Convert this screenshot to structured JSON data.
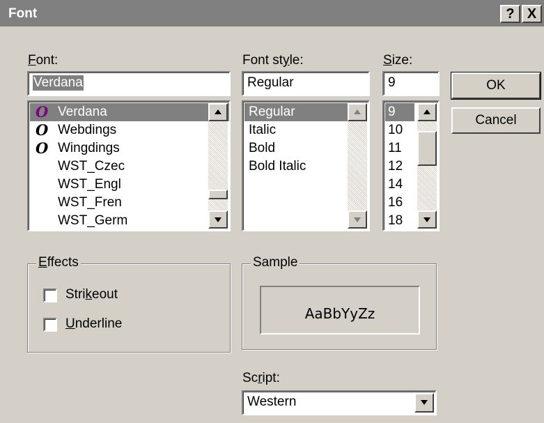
{
  "window": {
    "title": "Font",
    "help_label": "?",
    "close_label": "X"
  },
  "font": {
    "label_first": "F",
    "label_rest": "ont:",
    "value": "Verdana",
    "items": [
      {
        "name": "Verdana",
        "icon": "opentype-icon",
        "glyph": "O"
      },
      {
        "name": "Webdings",
        "icon": "opentype-icon",
        "glyph": "O"
      },
      {
        "name": "Wingdings",
        "icon": "opentype-icon",
        "glyph": "O"
      },
      {
        "name": "WST_Czec",
        "icon": "",
        "glyph": ""
      },
      {
        "name": "WST_Engl",
        "icon": "",
        "glyph": ""
      },
      {
        "name": "WST_Fren",
        "icon": "",
        "glyph": ""
      },
      {
        "name": "WST_Germ",
        "icon": "",
        "glyph": ""
      }
    ],
    "selected": "Verdana"
  },
  "style": {
    "label_pre": "Font st",
    "label_u": "y",
    "label_post": "le:",
    "value": "Regular",
    "items": [
      "Regular",
      "Italic",
      "Bold",
      "Bold Italic"
    ],
    "selected": "Regular"
  },
  "size": {
    "label_u": "S",
    "label_post": "ize:",
    "value": "9",
    "items": [
      "9",
      "10",
      "11",
      "12",
      "14",
      "16",
      "18"
    ],
    "selected": "9"
  },
  "buttons": {
    "ok": "OK",
    "cancel": "Cancel"
  },
  "effects": {
    "legend_u": "E",
    "legend_post": "ffects",
    "strikeout_pre": "Stri",
    "strikeout_u": "k",
    "strikeout_post": "eout",
    "underline_u": "U",
    "underline_post": "nderline",
    "strikeout_checked": false,
    "underline_checked": false
  },
  "sample": {
    "legend": "Sample",
    "text": "AaBbYyZz"
  },
  "script": {
    "label_pre": "Sc",
    "label_u": "r",
    "label_post": "ipt:",
    "value": "Western"
  },
  "colors": {
    "dialog_bg": "#d4d0c8",
    "titlebar": "#808080",
    "selection": "#808080",
    "opentype_purple": "#800080"
  }
}
